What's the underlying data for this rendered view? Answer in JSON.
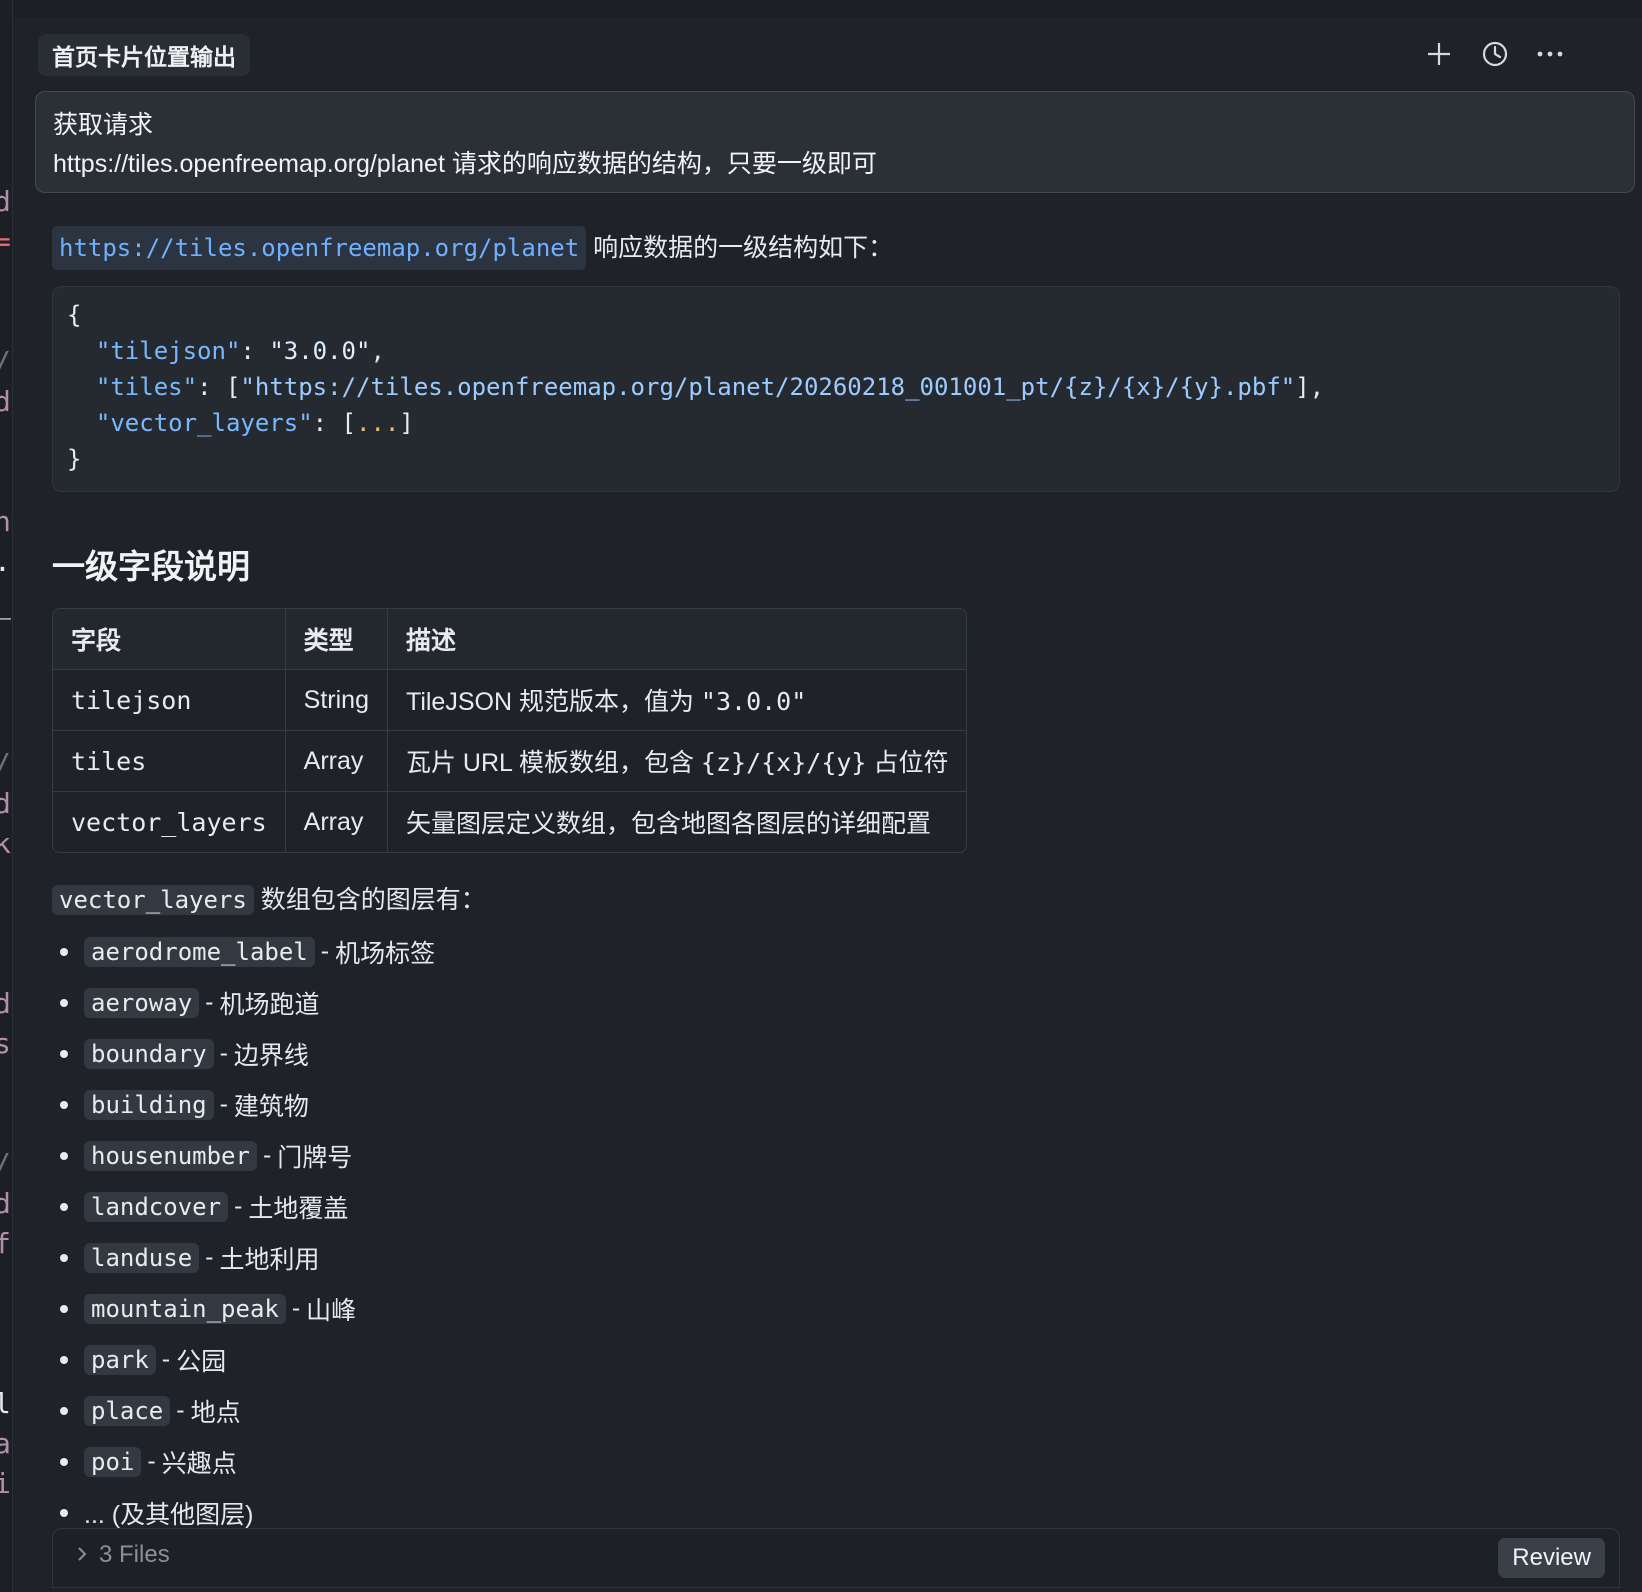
{
  "gutter": {
    "glyphs": [
      {
        "char": "d",
        "color": "#b48ead"
      },
      {
        "char": "=",
        "color": "#e06c75"
      },
      {
        "char": "/",
        "color": "#6b7280"
      },
      {
        "char": "d",
        "color": "#b48ead"
      },
      {
        "char": "n",
        "color": "#b48ead"
      },
      {
        "char": ".",
        "color": "#e8eaed"
      },
      {
        "char": "_",
        "color": "#e8eaed"
      },
      {
        "char": "/",
        "color": "#6b7280"
      },
      {
        "char": "d",
        "color": "#b48ead"
      },
      {
        "char": "k",
        "color": "#b48ead"
      },
      {
        "char": "d",
        "color": "#b48ead"
      },
      {
        "char": "s",
        "color": "#b48ead"
      },
      {
        "char": "/",
        "color": "#6b7280"
      },
      {
        "char": "d",
        "color": "#b48ead"
      },
      {
        "char": "f",
        "color": "#b48ead"
      },
      {
        "char": "l",
        "color": "#e8eaed"
      },
      {
        "char": "a",
        "color": "#b48ead"
      },
      {
        "char": "i",
        "color": "#b48ead"
      }
    ]
  },
  "header": {
    "chat_title": "首页卡片位置输出",
    "icons": [
      "plus-icon",
      "history-icon",
      "more-icon"
    ]
  },
  "prompt": {
    "line1": "获取请求",
    "line2": "https://tiles.openfreemap.org/planet 请求的响应数据的结构，只要一级即可"
  },
  "response": {
    "intro_link": "https://tiles.openfreemap.org/planet",
    "intro_text": " 响应数据的一级结构如下：",
    "code": {
      "open": "{",
      "close": "}",
      "lines": [
        {
          "key": "\"tilejson\"",
          "sep": ": ",
          "value": "\"3.0.0\"",
          "tail": ","
        },
        {
          "key": "\"tiles\"",
          "sep": ": [",
          "value": "\"https://tiles.openfreemap.org/planet/20260218_001001_pt/{z}/{x}/{y}.pbf\"",
          "tail": "],"
        },
        {
          "key": "\"vector_layers\"",
          "sep": ": [",
          "value": "...",
          "tail": "]"
        }
      ]
    },
    "section_title": "一级字段说明",
    "table": {
      "headers": [
        "字段",
        "类型",
        "描述"
      ],
      "rows": [
        {
          "field": "tilejson",
          "type": "String",
          "desc_prefix": "TileJSON 规范版本，值为 ",
          "desc_code": "\"3.0.0\"",
          "desc_suffix": ""
        },
        {
          "field": "tiles",
          "type": "Array",
          "desc_prefix": "瓦片 URL 模板数组，包含 ",
          "desc_code": "{z}/{x}/{y}",
          "desc_suffix": " 占位符"
        },
        {
          "field": "vector_layers",
          "type": "Array",
          "desc_prefix": "矢量图层定义数组，包含地图各图层的详细配置",
          "desc_code": "",
          "desc_suffix": ""
        }
      ]
    },
    "layers_intro_code": "vector_layers",
    "layers_intro_text": " 数组包含的图层有：",
    "layers": [
      {
        "name": "aerodrome_label",
        "desc": "机场标签"
      },
      {
        "name": "aeroway",
        "desc": "机场跑道"
      },
      {
        "name": "boundary",
        "desc": "边界线"
      },
      {
        "name": "building",
        "desc": "建筑物"
      },
      {
        "name": "housenumber",
        "desc": "门牌号"
      },
      {
        "name": "landcover",
        "desc": "土地覆盖"
      },
      {
        "name": "landuse",
        "desc": "土地利用"
      },
      {
        "name": "mountain_peak",
        "desc": "山峰"
      },
      {
        "name": "park",
        "desc": "公园"
      },
      {
        "name": "place",
        "desc": "地点"
      },
      {
        "name": "poi",
        "desc": "兴趣点"
      }
    ],
    "layers_more": "... (及其他图层)"
  },
  "footer": {
    "files_label": "3 Files",
    "review_label": "Review"
  }
}
